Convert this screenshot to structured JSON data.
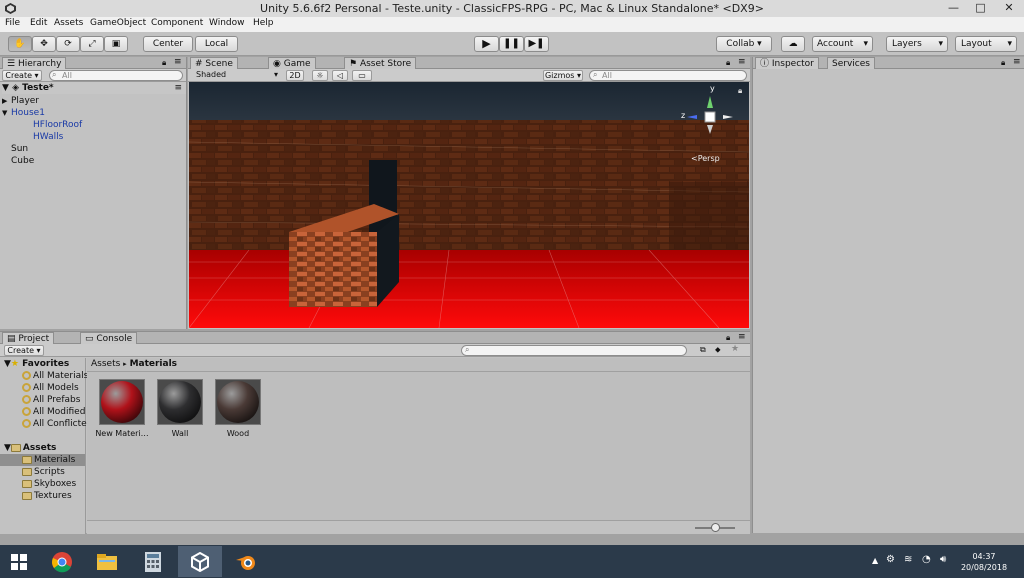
{
  "window": {
    "title": "Unity 5.6.6f2 Personal - Teste.unity - ClassicFPS-RPG - PC, Mac & Linux Standalone* <DX9>",
    "minimize": "—",
    "maximize": "□",
    "close": "✕"
  },
  "menu": [
    "File",
    "Edit",
    "Assets",
    "GameObject",
    "Component",
    "Window",
    "Help"
  ],
  "toolbar": {
    "pivot": "Center",
    "space": "Local",
    "collab": "Collab ▾",
    "account": "Account",
    "layers": "Layers",
    "layout": "Layout"
  },
  "hierarchy": {
    "tab": "Hierarchy",
    "create": "Create ▾",
    "search_placeholder": "All",
    "scene_name": "Teste*",
    "items": [
      {
        "label": "Player",
        "indent": 1,
        "arrow": "▶",
        "blue": false
      },
      {
        "label": "House1",
        "indent": 1,
        "arrow": "▼",
        "blue": true
      },
      {
        "label": "HFloorRoof",
        "indent": 2,
        "arrow": "",
        "blue": true
      },
      {
        "label": "HWalls",
        "indent": 2,
        "arrow": "",
        "blue": true
      },
      {
        "label": "Sun",
        "indent": 1,
        "arrow": "",
        "blue": false
      },
      {
        "label": "Cube",
        "indent": 1,
        "arrow": "",
        "blue": false
      }
    ]
  },
  "scene": {
    "tabs": [
      "Scene",
      "Game",
      "Asset Store"
    ],
    "shading": "Shaded",
    "mode_2d": "2D",
    "gizmos": "Gizmos ▾",
    "search_placeholder": "All",
    "persp_label": "<Persp",
    "axis_y": "y",
    "axis_z": "z"
  },
  "inspector": {
    "tabs": [
      "Inspector",
      "Services"
    ]
  },
  "project": {
    "tabs": [
      "Project",
      "Console"
    ],
    "create": "Create ▾",
    "favorites_label": "Favorites",
    "favorites": [
      "All Materials",
      "All Models",
      "All Prefabs",
      "All Modified",
      "All Conflicte"
    ],
    "assets_label": "Assets",
    "folders": [
      "Materials",
      "Scripts",
      "Skyboxes",
      "Textures"
    ],
    "breadcrumb_root": "Assets",
    "breadcrumb_sep": "▸",
    "breadcrumb_current": "Materials",
    "materials": [
      {
        "label": "New Materi…",
        "color": "#b0121a"
      },
      {
        "label": "Wall",
        "color": "#2e2e30"
      },
      {
        "label": "Wood",
        "color": "#4a3a36"
      }
    ]
  },
  "taskbar": {
    "time": "04:37",
    "date": "20/08/2018"
  },
  "colors": {
    "accent_play": "#111111",
    "floor_red": "#c80000",
    "wood": "#7a3b1e"
  }
}
